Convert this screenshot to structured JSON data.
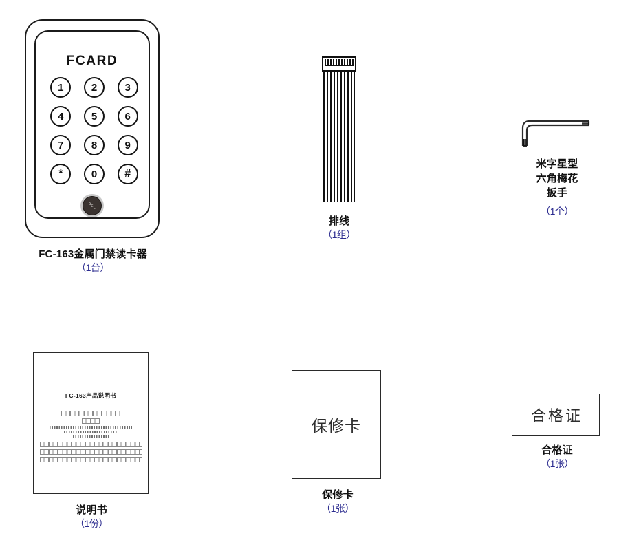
{
  "sheet": {
    "background_color": "#ffffff",
    "caption_color": "#111111",
    "quantity_color": "#2b2b8f"
  },
  "items": [
    {
      "id": "card-reader",
      "caption": "FC-163金属门禁读卡器",
      "quantity": "（1台）",
      "device": {
        "brand": "FCARD",
        "keys": [
          "1",
          "2",
          "3",
          "4",
          "5",
          "6",
          "7",
          "8",
          "9",
          "*",
          "0",
          "#"
        ],
        "bell_glyph": "␇",
        "bell_icon_name": "doorbell-icon"
      }
    },
    {
      "id": "ribbon-cable",
      "caption": "排线",
      "quantity": "（1组）"
    },
    {
      "id": "torx-wrench",
      "caption_lines": [
        "米字星型",
        "六角梅花",
        "扳手"
      ],
      "quantity": "（1个）"
    },
    {
      "id": "manual",
      "caption": "说明书",
      "quantity": "（1份）",
      "page": {
        "title": "FC-163产品说明书"
      }
    },
    {
      "id": "warranty-card",
      "caption": "保修卡",
      "quantity": "（1张）",
      "face_text": "保修卡"
    },
    {
      "id": "certificate",
      "caption": "合格证",
      "quantity": "（1张）",
      "face_text": "合格证"
    }
  ]
}
